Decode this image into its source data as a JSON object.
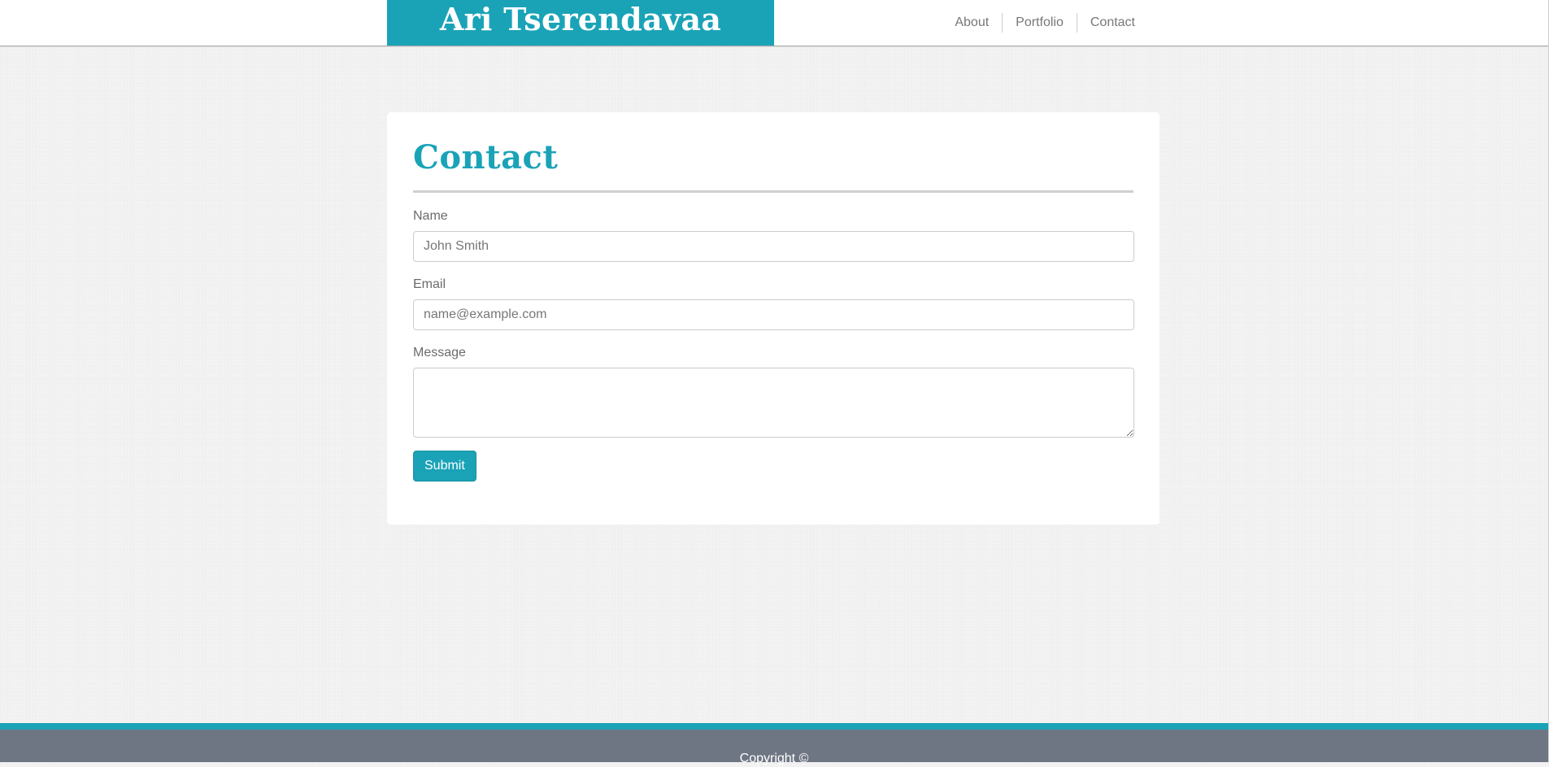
{
  "header": {
    "brand": "Ari Tserendavaa",
    "nav": [
      {
        "label": "About"
      },
      {
        "label": "Portfolio"
      },
      {
        "label": "Contact"
      }
    ]
  },
  "contact": {
    "title": "Contact",
    "fields": {
      "name": {
        "label": "Name",
        "placeholder": "John Smith",
        "value": ""
      },
      "email": {
        "label": "Email",
        "placeholder": "name@example.com",
        "value": ""
      },
      "message": {
        "label": "Message",
        "placeholder": "",
        "value": ""
      }
    },
    "submit_label": "Submit"
  },
  "footer": {
    "copyright": "Copyright ©"
  },
  "colors": {
    "accent": "#1aa3b7",
    "footer_bg": "#6f7683",
    "page_bg": "#f3f3f3",
    "text_muted": "#6b6b6b"
  }
}
